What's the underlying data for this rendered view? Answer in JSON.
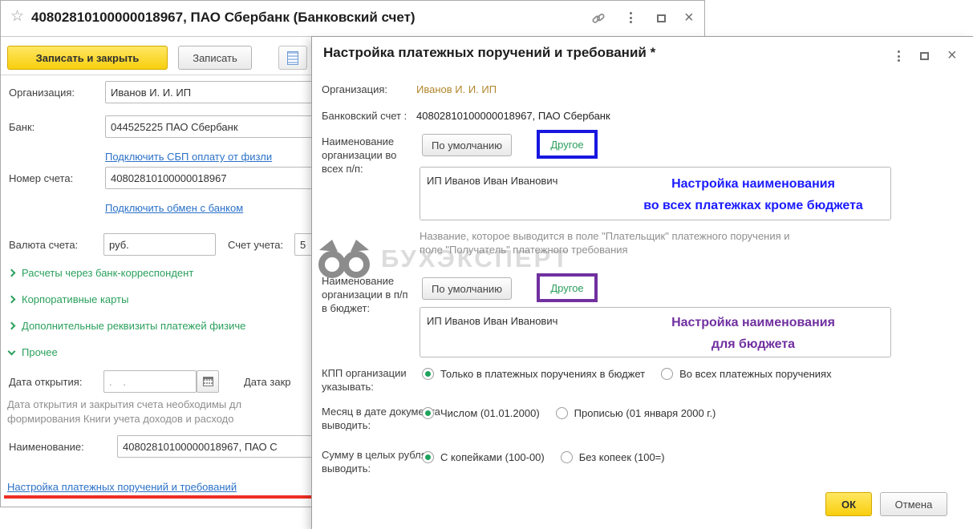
{
  "colors": {
    "accent_yellow": "#f8cf0e",
    "green_accent": "#2aa05c",
    "link_blue": "#2b71c8",
    "annotation_blue": "#1a1aff",
    "annotation_purple": "#7030a0",
    "annotation_red": "#ee2e24",
    "olive_value": "#b0872c"
  },
  "glyphs": {
    "star": "☆",
    "close": "×"
  },
  "main_window": {
    "title": "40802810100000018967, ПАО Сбербанк (Банковский счет)",
    "toolbar": {
      "save_and_close": "Записать и закрыть",
      "save": "Записать"
    },
    "form": {
      "org_label": "Организация:",
      "org_value": "Иванов И. И. ИП",
      "bank_label": "Банк:",
      "bank_value": "044525225 ПАО Сбербанк",
      "sbp_link": "Подключить СБП оплату от физли",
      "account_number_label": "Номер счета:",
      "account_number_value": "40802810100000018967",
      "bank_exchange_link": "Подключить обмен с банком",
      "currency_label": "Валюта счета:",
      "currency_value": "руб.",
      "ledger_label": "Счет учета:",
      "ledger_value": "5",
      "section_correspondent": "Расчеты через банк-корреспондент",
      "section_cards": "Корпоративные карты",
      "section_additional": "Дополнительные реквизиты платежей физиче",
      "section_other": "Прочее",
      "open_date_label": "Дата открытия:",
      "open_date_value": ".  .",
      "close_date_label": "Дата закр",
      "dates_hint_line1": "Дата открытия и закрытия счета необходимы дл",
      "dates_hint_line2": "формирования Книги учета доходов и расходо",
      "name_label": "Наименование:",
      "name_value": "40802810100000018967, ПАО С",
      "payment_settings_link": "Настройка платежных поручений и требований"
    }
  },
  "dialog": {
    "title": "Настройка платежных поручений и требований *",
    "org_label": "Организация:",
    "org_value": "Иванов И. И. ИП",
    "account_label": "Банковский счет :",
    "account_value": "40802810100000018967, ПАО Сбербанк",
    "toggle": {
      "default": "По умолчанию",
      "other": "Другое"
    },
    "name_all": {
      "label": "Наименование организации во всех п/п:",
      "value": "ИП Иванов Иван Иванович",
      "annotation_line1": "Настройка наименования",
      "annotation_line2": "во всех платежках кроме бюджета",
      "hint_line1": "Название, которое выводится в поле \"Плательщик\" платежного поручения и",
      "hint_line2": "поле \"Получатель\" платежного требования"
    },
    "name_budget": {
      "label": "Наименование организации в п/п в бюджет:",
      "value": "ИП Иванов Иван Иванович",
      "annotation_line1": "Настройка наименования",
      "annotation_line2": "для бюджета"
    },
    "kpp": {
      "label": "КПП организации указывать:",
      "option_budget_only": "Только в платежных поручениях в бюджет",
      "option_all": "Во всех платежных поручениях"
    },
    "month": {
      "label": "Месяц в дате документа выводить:",
      "option_numeric": "Числом (01.01.2000)",
      "option_words": "Прописью (01 января 2000 г.)"
    },
    "amount": {
      "label": "Сумму в целых рублях выводить:",
      "option_kopecks": "С копейками (100-00)",
      "option_no_kopecks": "Без копеек (100=)"
    },
    "ok": "ОК",
    "cancel": "Отмена"
  },
  "watermark": {
    "text": "БУХЭКСПЕРТ"
  }
}
